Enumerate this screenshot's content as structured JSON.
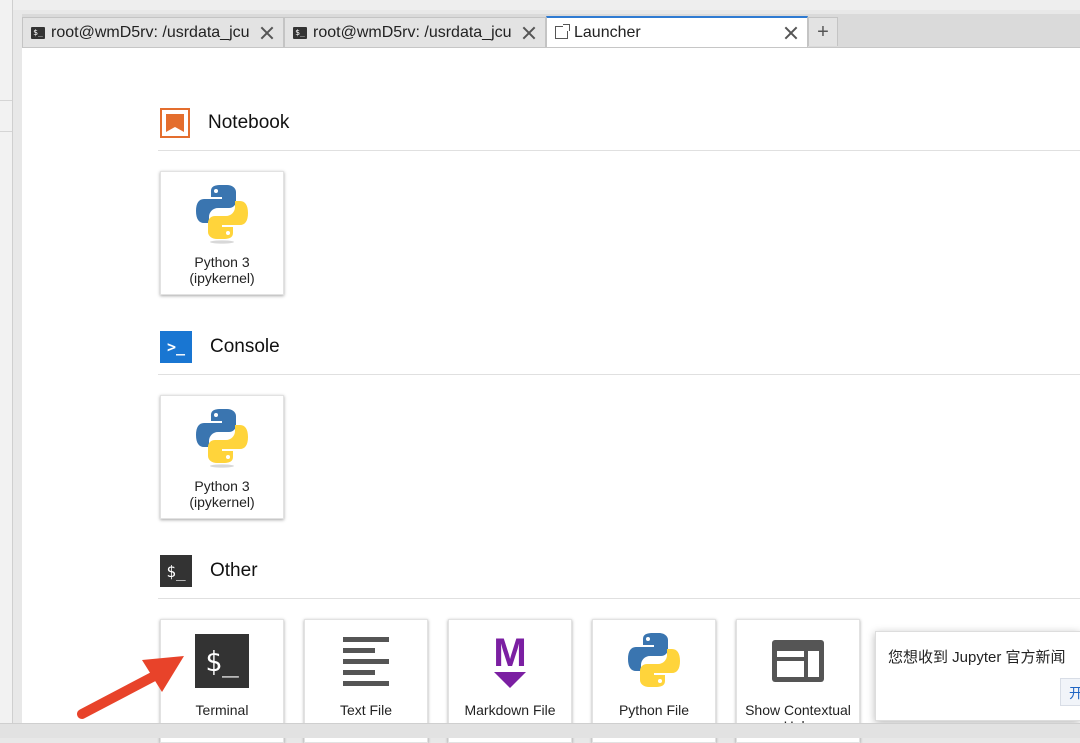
{
  "tabs": [
    {
      "label": "root@wmD5rv: /usrdata_jcu",
      "icon": "terminal-icon",
      "active": false
    },
    {
      "label": "root@wmD5rv: /usrdata_jcu",
      "icon": "terminal-icon",
      "active": false
    },
    {
      "label": "Launcher",
      "icon": "launcher-icon",
      "active": true
    }
  ],
  "add_tab_label": "+",
  "launcher": {
    "sections": [
      {
        "title": "Notebook",
        "icon": "notebook-icon",
        "cards": [
          {
            "label": "Python 3 (ipykernel)",
            "icon": "python-logo-icon"
          }
        ]
      },
      {
        "title": "Console",
        "icon": "console-icon",
        "icon_text": ">_",
        "cards": [
          {
            "label": "Python 3 (ipykernel)",
            "icon": "python-logo-icon"
          }
        ]
      },
      {
        "title": "Other",
        "icon": "other-terminal-icon",
        "icon_text": "$_",
        "cards": [
          {
            "label": "Terminal",
            "icon": "terminal-icon",
            "icon_text": "$_"
          },
          {
            "label": "Text File",
            "icon": "text-file-icon"
          },
          {
            "label": "Markdown File",
            "icon": "markdown-icon",
            "icon_text": "M"
          },
          {
            "label": "Python File",
            "icon": "python-logo-icon"
          },
          {
            "label": "Show Contextual Help",
            "icon": "contextual-help-icon"
          }
        ]
      }
    ]
  },
  "notification": {
    "message": "您想收到 Jupyter 官方新闻",
    "button_label": "开"
  },
  "colors": {
    "accent": "#2e7ad1",
    "notebook_orange": "#e46e2e",
    "console_blue": "#1976d2",
    "markdown_purple": "#7b1fa2",
    "python_blue": "#3a75b0",
    "python_yellow": "#ffd43b",
    "annotation_arrow": "#e8432a"
  }
}
